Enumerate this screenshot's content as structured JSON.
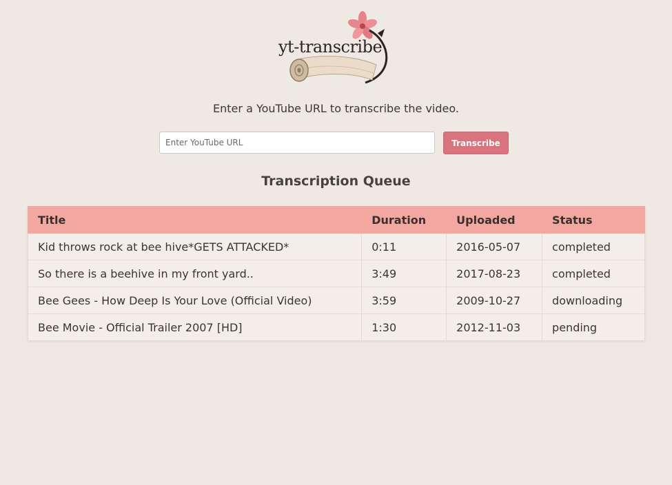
{
  "app": {
    "logo_text": "yt-transcribe",
    "accent_color": "#d9737d",
    "header_color": "#f2a8a0",
    "background_color": "#efe9e4"
  },
  "intro_text": "Enter a YouTube URL to transcribe the video.",
  "url_input": {
    "placeholder": "Enter YouTube URL",
    "value": ""
  },
  "transcribe_button": {
    "label": "Transcribe"
  },
  "queue": {
    "title": "Transcription Queue",
    "columns": [
      "Title",
      "Duration",
      "Uploaded",
      "Status"
    ],
    "rows": [
      {
        "title": "Kid throws rock at bee hive*GETS ATTACKED*",
        "duration": "0:11",
        "uploaded": "2016-05-07",
        "status": "completed"
      },
      {
        "title": "So there is a beehive in my front yard..",
        "duration": "3:49",
        "uploaded": "2017-08-23",
        "status": "completed"
      },
      {
        "title": "Bee Gees - How Deep Is Your Love (Official Video)",
        "duration": "3:59",
        "uploaded": "2009-10-27",
        "status": "downloading"
      },
      {
        "title": "Bee Movie - Official Trailer 2007 [HD]",
        "duration": "1:30",
        "uploaded": "2012-11-03",
        "status": "pending"
      }
    ]
  }
}
